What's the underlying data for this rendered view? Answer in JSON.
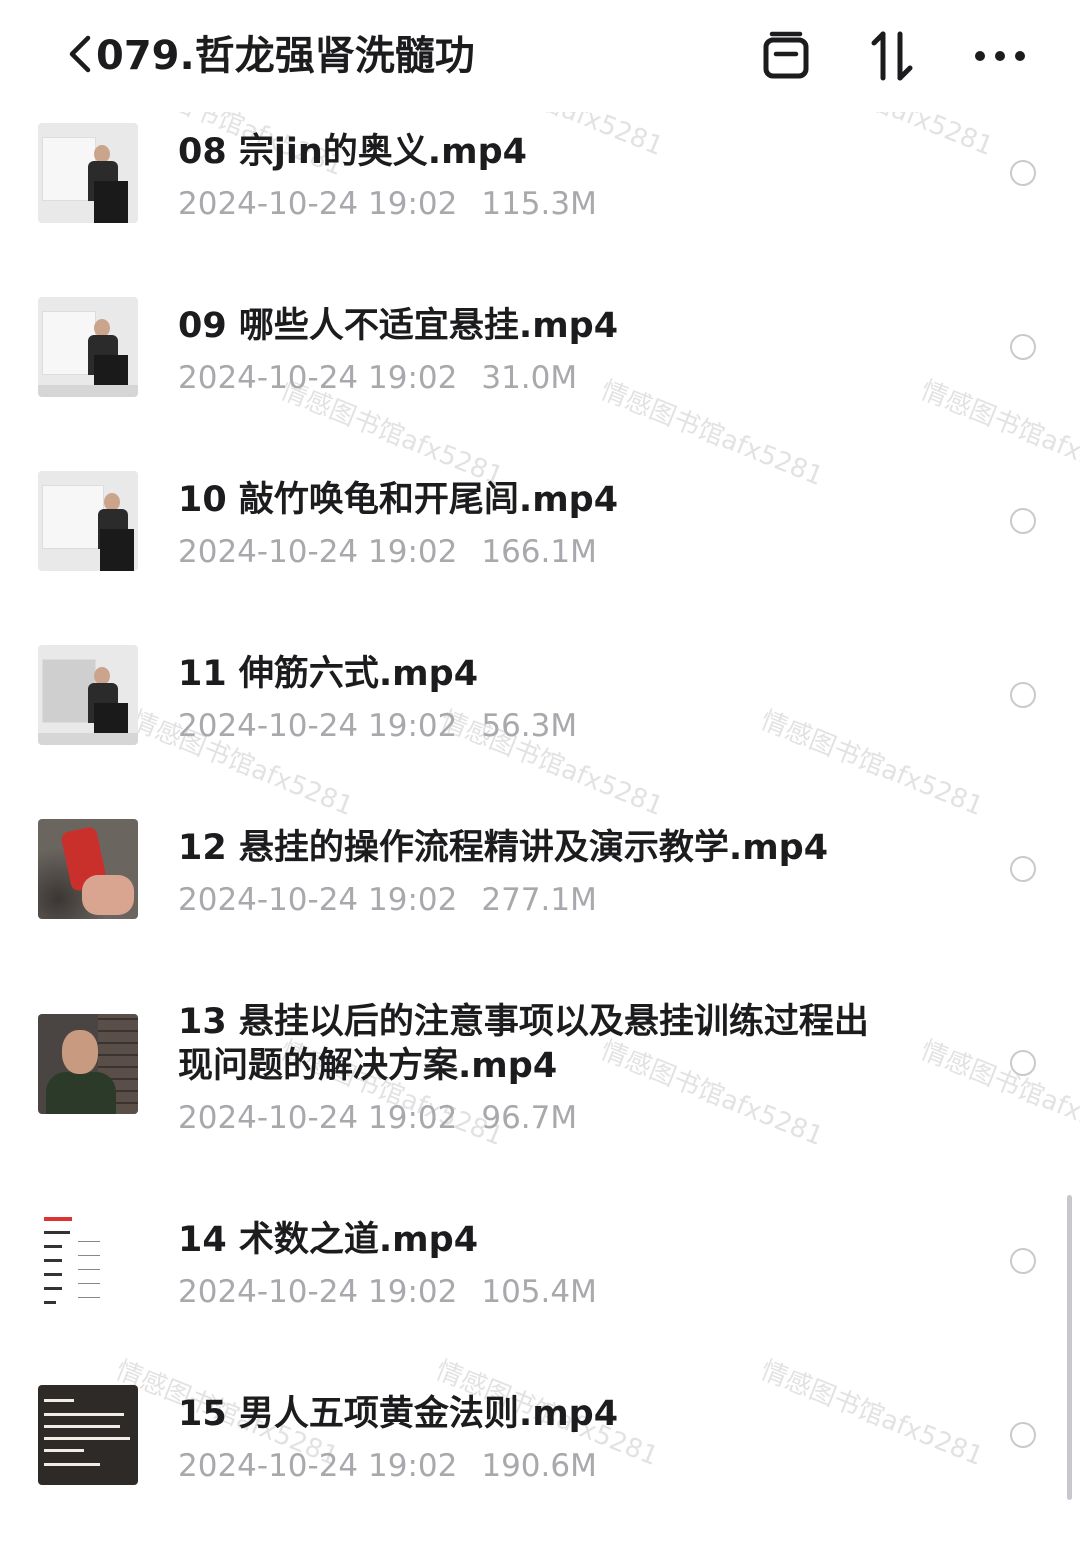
{
  "header": {
    "title": "079.哲龙强肾洗髓功"
  },
  "icons": {
    "back": "chevron-left-icon",
    "select_all": "select-box-icon",
    "sort": "sort-arrows-icon",
    "more": "more-dots-icon"
  },
  "files": [
    {
      "name": "08 宗jin的奥义.mp4",
      "date": "2024-10-24 19:02",
      "size": "115.3M"
    },
    {
      "name": "09 哪些人不适宜悬挂.mp4",
      "date": "2024-10-24 19:02",
      "size": "31.0M"
    },
    {
      "name": "10 敲竹唤龟和开尾闾.mp4",
      "date": "2024-10-24 19:02",
      "size": "166.1M"
    },
    {
      "name": "11 伸筋六式.mp4",
      "date": "2024-10-24 19:02",
      "size": "56.3M"
    },
    {
      "name": "12 悬挂的操作流程精讲及演示教学.mp4",
      "date": "2024-10-24 19:02",
      "size": "277.1M"
    },
    {
      "name": "13 悬挂以后的注意事项以及悬挂训练过程出现问题的解决方案.mp4",
      "date": "2024-10-24 19:02",
      "size": "96.7M"
    },
    {
      "name": "14 术数之道.mp4",
      "date": "2024-10-24 19:02",
      "size": "105.4M"
    },
    {
      "name": "15 男人五项黄金法则.mp4",
      "date": "2024-10-24 19:02",
      "size": "190.6M"
    }
  ],
  "watermark": "情感图书馆afx5281",
  "colors": {
    "text": "#1c1c1e",
    "meta": "#a8a8ad",
    "radio": "#c9c9ce"
  }
}
